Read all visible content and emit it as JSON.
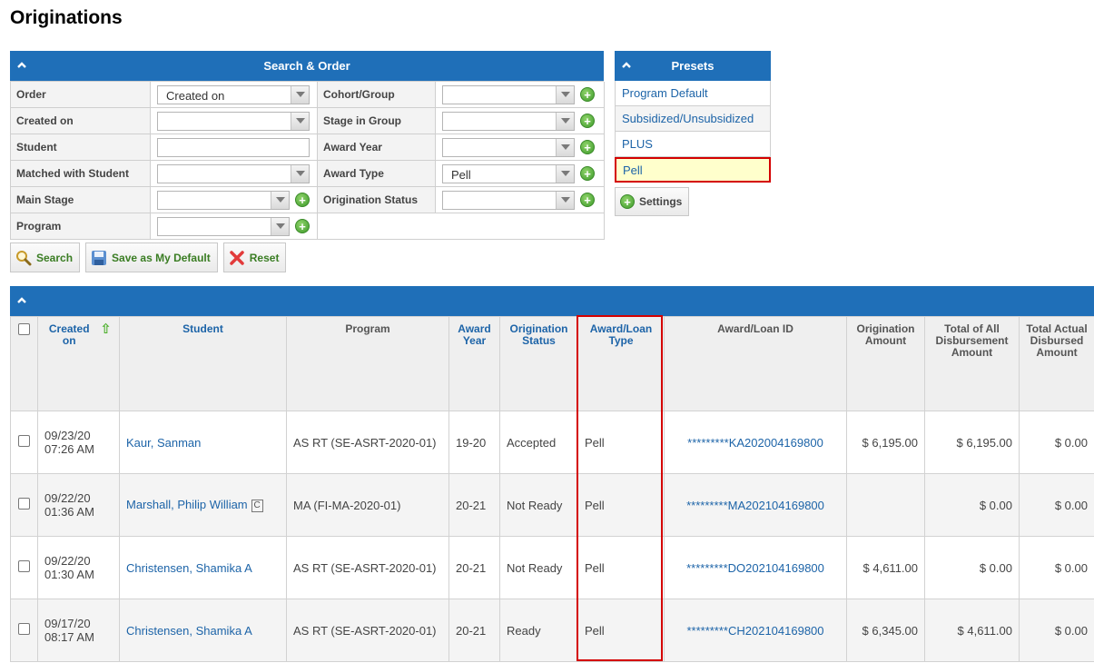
{
  "page": {
    "title": "Originations"
  },
  "search": {
    "header": "Search & Order",
    "rows": [
      {
        "label": "Order",
        "value": "Created on",
        "label2": "Cohort/Group",
        "value2": ""
      },
      {
        "label": "Created on",
        "value": "",
        "label2": "Stage in Group",
        "value2": ""
      },
      {
        "label": "Student",
        "value": "",
        "label2": "Award Year",
        "value2": ""
      },
      {
        "label": "Matched with Student",
        "value": "",
        "label2": "Award Type",
        "value2": "Pell"
      },
      {
        "label": "Main Stage",
        "value": "",
        "label2": "Origination Status",
        "value2": ""
      },
      {
        "label": "Program",
        "value": ""
      }
    ],
    "buttons": {
      "search": "Search",
      "save_default": "Save as My Default",
      "reset": "Reset"
    }
  },
  "presets": {
    "header": "Presets",
    "items": [
      "Program Default",
      "Subsidized/Unsubsidized",
      "PLUS",
      "Pell"
    ],
    "active": "Pell",
    "settings_label": "Settings"
  },
  "results": {
    "columns": {
      "created_on": "Created on",
      "student": "Student",
      "program": "Program",
      "award_year": "Award Year",
      "origination_status": "Origination Status",
      "award_loan_type": "Award/Loan Type",
      "award_loan_id": "Award/Loan ID",
      "origination_amount": "Origination Amount",
      "total_all_disbursement": "Total of All Disbursement Amount",
      "total_actual_disbursed": "Total Actual Disbursed Amount"
    },
    "rows": [
      {
        "date": "09/23/20",
        "time": "07:26 AM",
        "student": "Kaur, Sanman",
        "program": "AS RT (SE-ASRT-2020-01)",
        "award_year": "19-20",
        "status": "Accepted",
        "type": "Pell",
        "id": "*********KA202004169800",
        "orig_amount": "$ 6,195.00",
        "total_all": "$ 6,195.00",
        "total_actual": "$ 0.00"
      },
      {
        "date": "09/22/20",
        "time": "01:36 AM",
        "student": "Marshall, Philip William",
        "badge": "C",
        "program": "MA (FI-MA-2020-01)",
        "award_year": "20-21",
        "status": "Not Ready",
        "type": "Pell",
        "id": "*********MA202104169800",
        "orig_amount": "",
        "total_all": "$ 0.00",
        "total_actual": "$ 0.00"
      },
      {
        "date": "09/22/20",
        "time": "01:30 AM",
        "student": "Christensen, Shamika A",
        "program": "AS RT (SE-ASRT-2020-01)",
        "award_year": "20-21",
        "status": "Not Ready",
        "type": "Pell",
        "id": "*********DO202104169800",
        "orig_amount": "$ 4,611.00",
        "total_all": "$ 0.00",
        "total_actual": "$ 0.00"
      },
      {
        "date": "09/17/20",
        "time": "08:17 AM",
        "student": "Christensen, Shamika A",
        "program": "AS RT (SE-ASRT-2020-01)",
        "award_year": "20-21",
        "status": "Ready",
        "type": "Pell",
        "id": "*********CH202104169800",
        "orig_amount": "$ 6,345.00",
        "total_all": "$ 4,611.00",
        "total_actual": "$ 0.00"
      }
    ]
  },
  "colors": {
    "header_blue": "#1f6fb8",
    "link_blue": "#1d64a8",
    "highlight_red": "#d40000",
    "active_preset_bg": "#ffffcc"
  }
}
